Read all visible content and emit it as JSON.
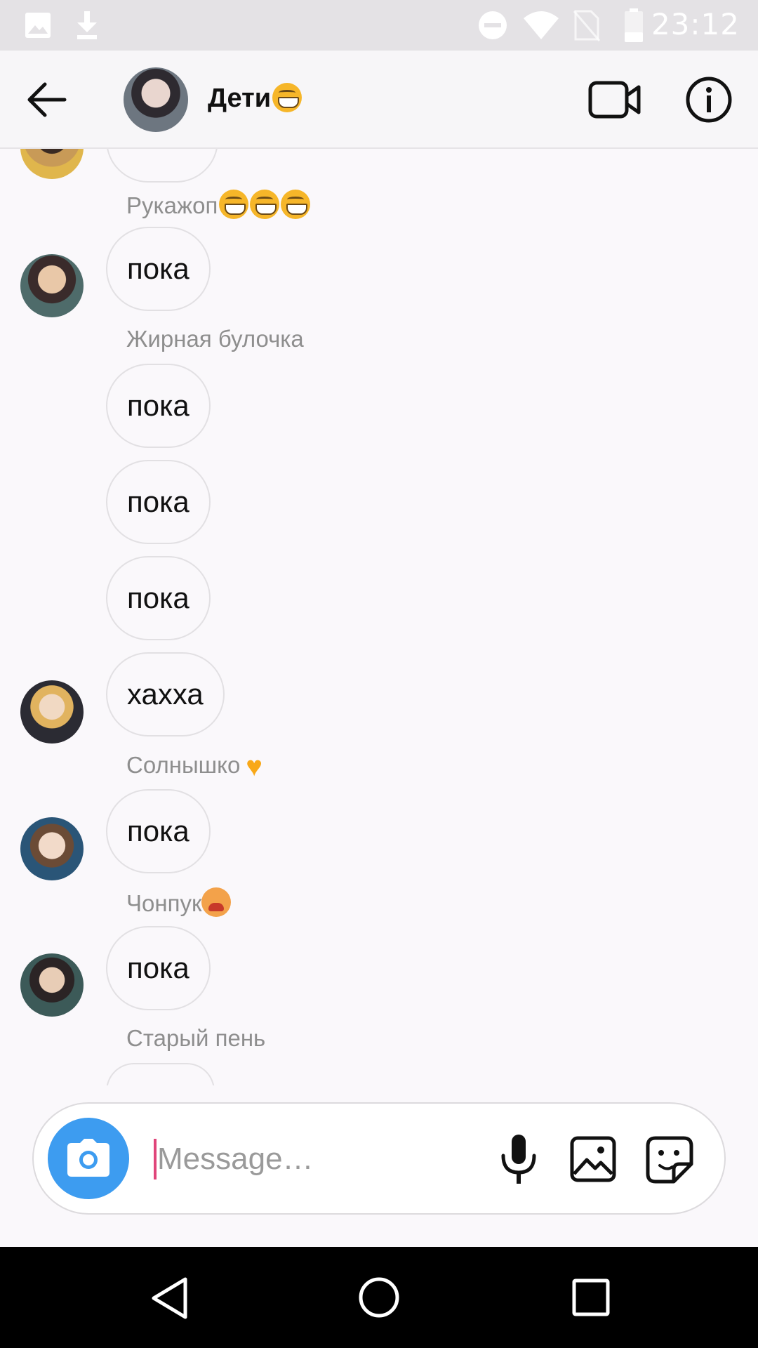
{
  "status_bar": {
    "time": "23:12",
    "icons": [
      "image-icon",
      "download-icon",
      "do-not-disturb-icon",
      "wifi-icon",
      "no-sim-icon",
      "battery-icon"
    ]
  },
  "header": {
    "title": "Дети",
    "icons": [
      "back-arrow-icon",
      "video-call-icon",
      "info-icon"
    ]
  },
  "messages": [
    {
      "sender": "Рукажоп",
      "text": "пока"
    },
    {
      "sender": "Жирная булочка",
      "texts": [
        "пока",
        "пока",
        "пока",
        "хахха"
      ]
    },
    {
      "sender": "Солнышко",
      "text": "пока"
    },
    {
      "sender": "Чонпук",
      "text": "пока"
    },
    {
      "sender": "Старый пень"
    }
  ],
  "composer": {
    "placeholder": "Message…",
    "icons": [
      "camera-icon",
      "microphone-icon",
      "gallery-icon",
      "sticker-icon"
    ]
  },
  "colors": {
    "accent_blue": "#3d9cf0",
    "cursor_pink": "#e0457a",
    "heart_yellow": "#f8a818"
  }
}
